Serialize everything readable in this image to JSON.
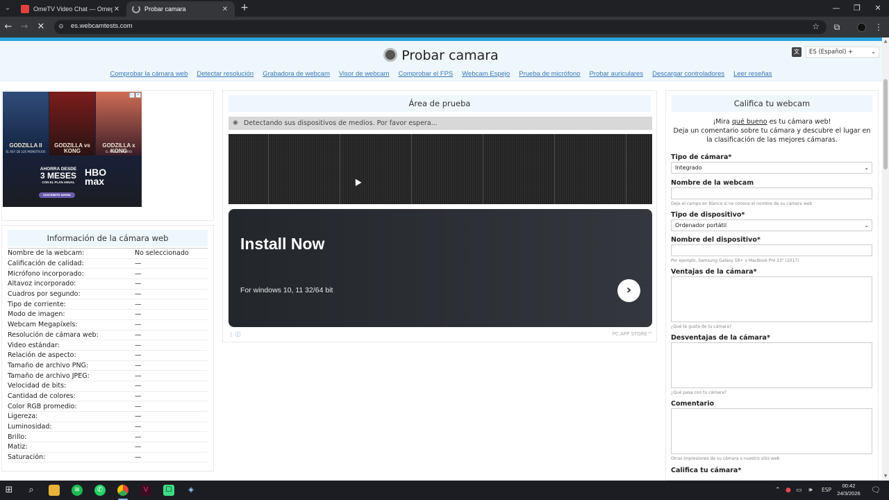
{
  "browser": {
    "tabs": [
      {
        "title": "OmeTV Video Chat — Omegle",
        "active": false
      },
      {
        "title": "Probar camara",
        "active": true
      }
    ],
    "url": "es.webcamtests.com",
    "accent_color": "#35363a"
  },
  "header": {
    "title": "Probar camara",
    "language": "ES (Español) +",
    "nav": [
      "Comprobar la cámara web",
      "Detectar resolución",
      "Grabadora de webcam",
      "Visor de webcam",
      "Comprobar el FPS",
      "Webcam Espejo",
      "Prueba de micrófono",
      "Probar auriculares",
      "Descargar controladores",
      "Leer reseñas"
    ]
  },
  "left_ad": {
    "posters": [
      {
        "title": "GODZILLA II",
        "subtitle": "EL REY DE LOS MONSTRUOS"
      },
      {
        "title": "GODZILLA vs KONG",
        "subtitle": ""
      },
      {
        "title": "GODZILLA x KONG",
        "subtitle": "EL NUEVO IMPERIO"
      }
    ],
    "promo_line1": "AHORRA DESDE",
    "promo_line2": "3 MESES",
    "promo_line3": "CON EL PLAN ANUAL",
    "cta": "SUSCRÍBETE AHORA",
    "brand": "HBO max"
  },
  "info_panel": {
    "title": "Información de la cámara web",
    "rows": [
      {
        "k": "Nombre de la webcam:",
        "v": "No seleccionado"
      },
      {
        "k": "Calificación de calidad:",
        "v": "—"
      },
      {
        "k": "Micrófono incorporado:",
        "v": "—"
      },
      {
        "k": "Altavoz incorporado:",
        "v": "—"
      },
      {
        "k": "Cuadros por segundo:",
        "v": "—"
      },
      {
        "k": "Tipo de corriente:",
        "v": "—"
      },
      {
        "k": "Modo de imagen:",
        "v": "—"
      },
      {
        "k": "Webcam Megapíxels:",
        "v": "—"
      },
      {
        "k": "Resolución de cámara web:",
        "v": "—"
      },
      {
        "k": "Video estándar:",
        "v": "—"
      },
      {
        "k": "Relación de aspecto:",
        "v": "—"
      },
      {
        "k": "Tamaño de archivo PNG:",
        "v": "—"
      },
      {
        "k": "Tamaño de archivo JPEG:",
        "v": "—"
      },
      {
        "k": "Velocidad de bits:",
        "v": "—"
      },
      {
        "k": "Cantidad de colores:",
        "v": "—"
      },
      {
        "k": "Color RGB promedio:",
        "v": "—"
      },
      {
        "k": "Ligereza:",
        "v": "—"
      },
      {
        "k": "Luminosidad:",
        "v": "—"
      },
      {
        "k": "Brillo:",
        "v": "—"
      },
      {
        "k": "Matiz:",
        "v": "—"
      },
      {
        "k": "Saturación:",
        "v": "—"
      }
    ]
  },
  "test_area": {
    "title": "Área de prueba",
    "status": "Detectando sus dispositivos de medios. Por favor espera...",
    "ad_headline": "Install Now",
    "ad_sub": "For windows 10, 11 32/64 bit",
    "ad_store": "PC APP STORE™"
  },
  "rate_panel": {
    "title": "Califica tu webcam",
    "intro_pre": "¡Mira ",
    "intro_link": "qué bueno",
    "intro_post": " es tu cámara web!",
    "intro_line2": "Deja un comentario sobre tu cámara y descubre el lugar en la clasificación de las mejores cámaras.",
    "camera_type_label": "Tipo de cámara*",
    "camera_type_value": "Integrado",
    "webcam_name_label": "Nombre de la webcam",
    "webcam_name_hint": "Deje el campo en blanco si no conoce el nombre de su cámara web",
    "device_type_label": "Tipo de dispositivo*",
    "device_type_value": "Ordenador portátil",
    "device_name_label": "Nombre del dispositivo*",
    "device_name_hint": "Por ejemplo, Samsung Galaxy S8+ o MacBook Pro 13\" (2017)",
    "pros_label": "Ventajas de la cámara*",
    "pros_hint": "¿Qué te gusta de tu cámara?",
    "cons_label": "Desventajas de la cámara*",
    "cons_hint": "¿Qué pasa con tu cámara?",
    "comment_label": "Comentario",
    "comment_hint": "Otras impresiones de su cámara o nuestro sitio web",
    "rate_label": "Califica tu cámara*"
  },
  "taskbar": {
    "language": "ESP",
    "time": "00:42",
    "date": "24/3/2026"
  }
}
